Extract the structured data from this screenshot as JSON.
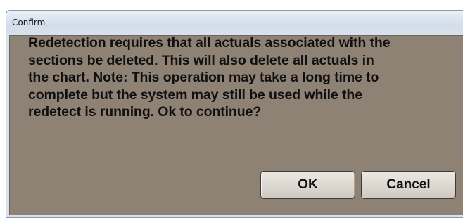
{
  "window": {
    "title": "Confirm"
  },
  "dialog": {
    "message_lines": [
      "Redetection requires that all actuals associated with the",
      "sections be deleted.  This will also delete all actuals in",
      "the chart.  Note:  This operation may take a long time to",
      "complete but the system may still be used while the",
      "redetect is running.  Ok to continue?"
    ],
    "ok_label": "OK",
    "cancel_label": "Cancel"
  },
  "colors": {
    "dialog_background": "#8e8275",
    "titlebar": "#d8e2ee",
    "button_face": "#ddd8d1"
  }
}
